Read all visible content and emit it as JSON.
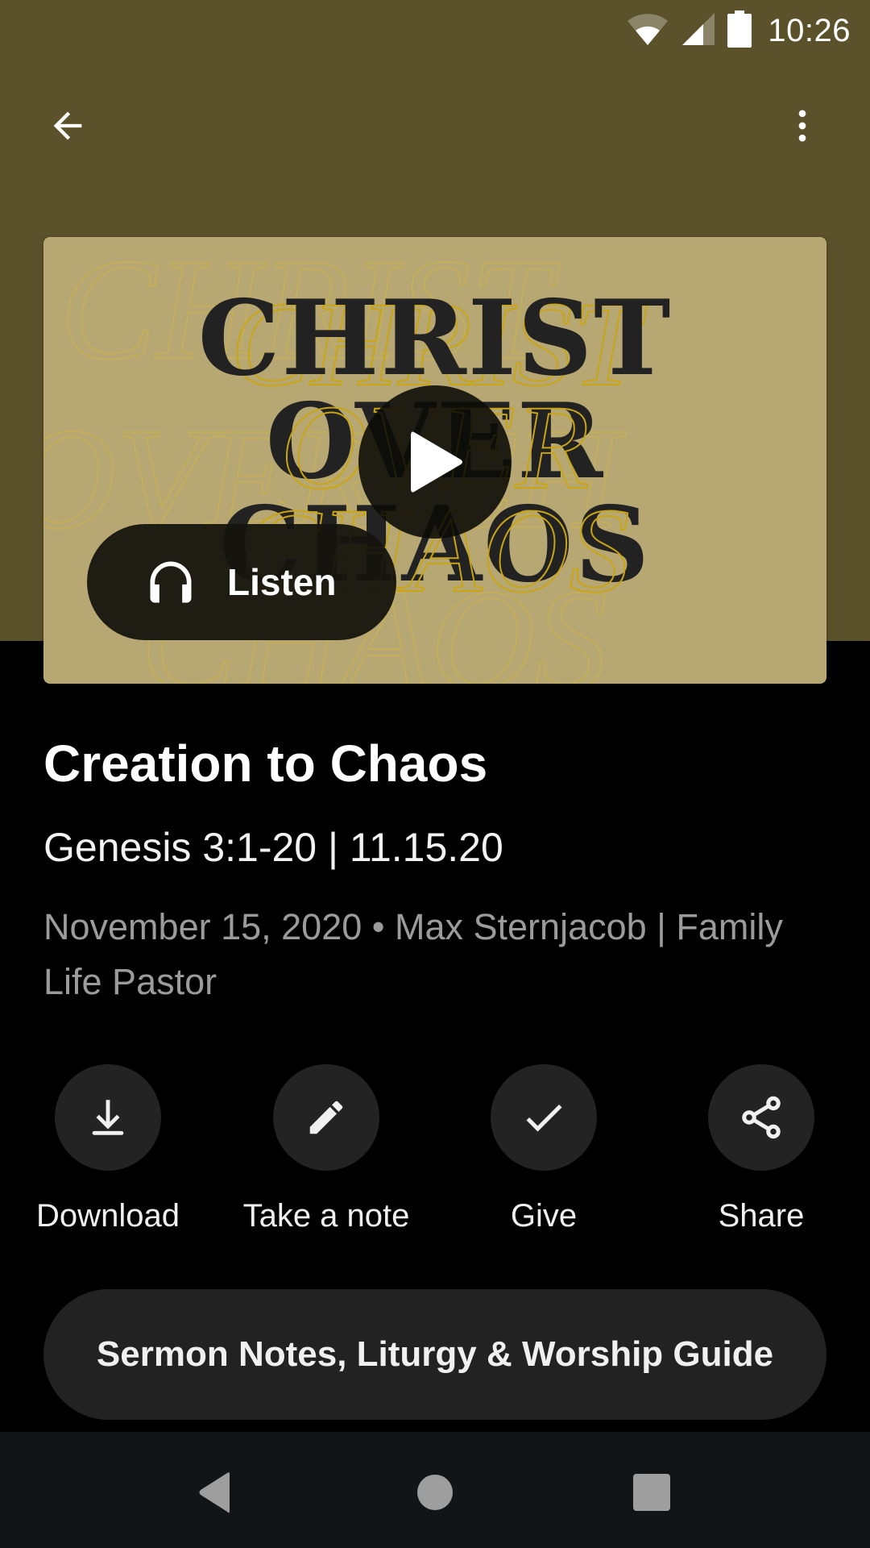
{
  "status_bar": {
    "time": "10:26",
    "icons": [
      "wifi-icon",
      "cell-signal-icon",
      "battery-icon"
    ]
  },
  "app_bar": {
    "back_icon": "arrow-left-icon",
    "menu_icon": "more-vertical-icon"
  },
  "artwork": {
    "series_title_lines": [
      "CHRIST",
      "OVER",
      "CHAOS"
    ],
    "play_icon": "play-icon",
    "listen_label": "Listen",
    "listen_icon": "headphones-icon"
  },
  "sermon": {
    "title": "Creation to Chaos",
    "subtitle": "Genesis 3:1-20 | 11.15.20",
    "meta": "November 15, 2020 • Max Sternjacob | Family Life Pastor"
  },
  "actions": [
    {
      "label": "Download",
      "icon": "download-icon"
    },
    {
      "label": "Take a note",
      "icon": "pencil-icon"
    },
    {
      "label": "Give",
      "icon": "checkmark-icon"
    },
    {
      "label": "Share",
      "icon": "share-icon"
    }
  ],
  "guide_button": {
    "label": "Sermon Notes, Liturgy & Worship Guide"
  },
  "colors": {
    "header_bg": "#5b522c",
    "artwork_bg": "#b7a772",
    "artwork_accent": "#c9a515",
    "page_bg": "#000000",
    "button_bg": "#222222",
    "nav_bar_bg": "#131416",
    "meta_text": "#9b9b9b"
  }
}
